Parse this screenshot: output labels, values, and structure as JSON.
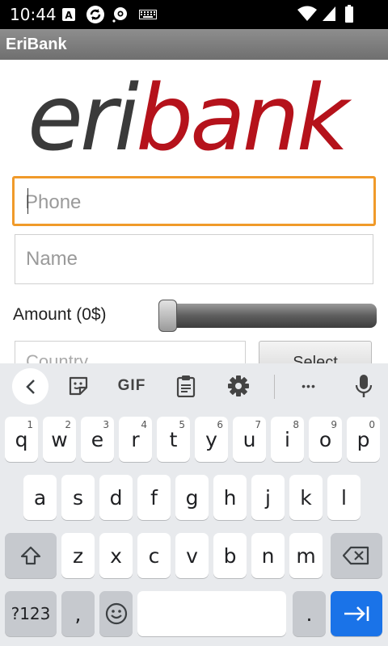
{
  "status_bar": {
    "time": "10:44"
  },
  "app": {
    "title": "EriBank"
  },
  "logo": {
    "part1": "eri",
    "part2": "bank",
    "color1": "#3a3a3a",
    "color2": "#b5121b"
  },
  "form": {
    "phone_placeholder": "Phone",
    "name_placeholder": "Name",
    "amount_label": "Amount (0$)",
    "amount_value": 0,
    "country_placeholder": "Country",
    "select_label": "Select"
  },
  "keyboard": {
    "toolbar": {
      "gif_label": "GIF",
      "more_label": "•••"
    },
    "row1": [
      {
        "key": "q",
        "hint": "1"
      },
      {
        "key": "w",
        "hint": "2"
      },
      {
        "key": "e",
        "hint": "3"
      },
      {
        "key": "r",
        "hint": "4"
      },
      {
        "key": "t",
        "hint": "5"
      },
      {
        "key": "y",
        "hint": "6"
      },
      {
        "key": "u",
        "hint": "7"
      },
      {
        "key": "i",
        "hint": "8"
      },
      {
        "key": "o",
        "hint": "9"
      },
      {
        "key": "p",
        "hint": "0"
      }
    ],
    "row2": [
      "a",
      "s",
      "d",
      "f",
      "g",
      "h",
      "j",
      "k",
      "l"
    ],
    "row3": [
      "z",
      "x",
      "c",
      "v",
      "b",
      "n",
      "m"
    ],
    "symbols_label": "?123",
    "comma_label": ",",
    "period_label": "."
  }
}
